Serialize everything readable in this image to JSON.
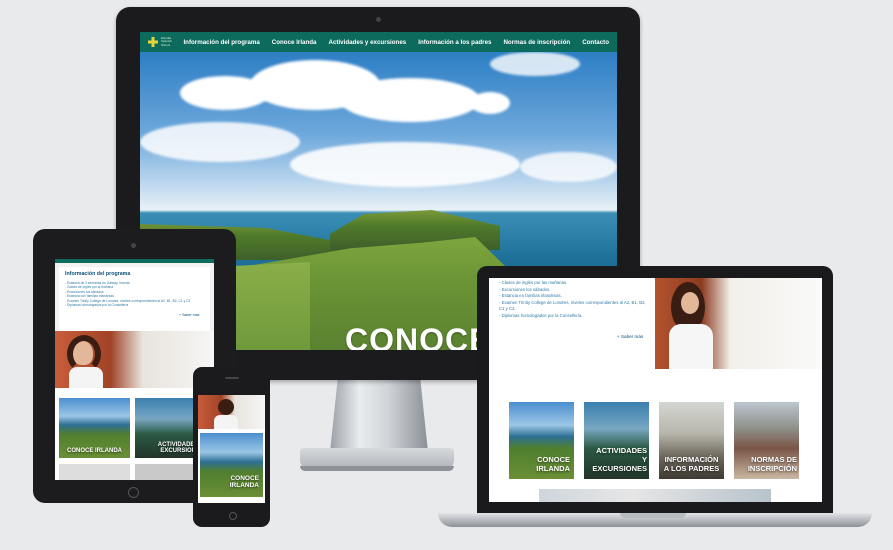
{
  "site": {
    "logo_text": [
      "Estudia",
      "Spanish",
      "School"
    ],
    "nav": [
      "Información del programa",
      "Conoce Irlanda",
      "Actividades y excursiones",
      "Información a los padres",
      "Normas de inscripción",
      "Contacto"
    ],
    "hero_title": "CONOCE I"
  },
  "program_panel": {
    "title": "Información del programa",
    "items": [
      "- Estancia de 3 semanas en Galway, Irlanda",
      "- Clases de inglés por la mañana",
      "- Excursiones los sábados",
      "- Estancia con familias irlandesas",
      "- Examen Trinity College de Londres, niveles correspondientes al A2, B1, B2, C1 y C2",
      "- Diplomas homologados por la Consellería"
    ],
    "more_label": "+ Saber más"
  },
  "laptop_panel": {
    "items": [
      "- Clases de inglés por las mañanas.",
      "- Excursiones los sábados.",
      "- Estancia en familias irlandesas.",
      "- Examen Trinity College de Londres, niveles correspondientes al A2, B1, B2, C1 y C2.",
      "- Diplomas homologados por la Consellería."
    ],
    "more_label": "+ Saber más"
  },
  "tiles": {
    "ireland": "CONOCE IRLANDA",
    "activities": "ACTIVIDADES Y EXCURSIONES",
    "parents": "INFORMACIÓN A LOS PADRES",
    "rules": "NORMAS DE INSCRIPCIÓN"
  },
  "tablet_tiles": {
    "ireland": "CONOCE IRLANDA",
    "activities": "ACTIVIDADES Y EXCURSIONES"
  },
  "laptop_tiles": [
    {
      "l1": "CONOCE",
      "l2": "IRLANDA"
    },
    {
      "l1": "ACTIVIDADES",
      "l2": "Y",
      "l3": "EXCURSIONES"
    },
    {
      "l1": "INFORMACIÓN",
      "l2": "A LOS PADRES"
    },
    {
      "l1": "NORMAS DE",
      "l2": "INSCRIPCIÓN"
    }
  ],
  "phone_tile": {
    "l1": "CONOCE",
    "l2": "IRLANDA"
  },
  "colors": {
    "brand_green": "#0d6b5e",
    "logo_yellow": "#e7d33a",
    "link_blue": "#2f7aa6",
    "title_blue": "#0b4f7a"
  }
}
